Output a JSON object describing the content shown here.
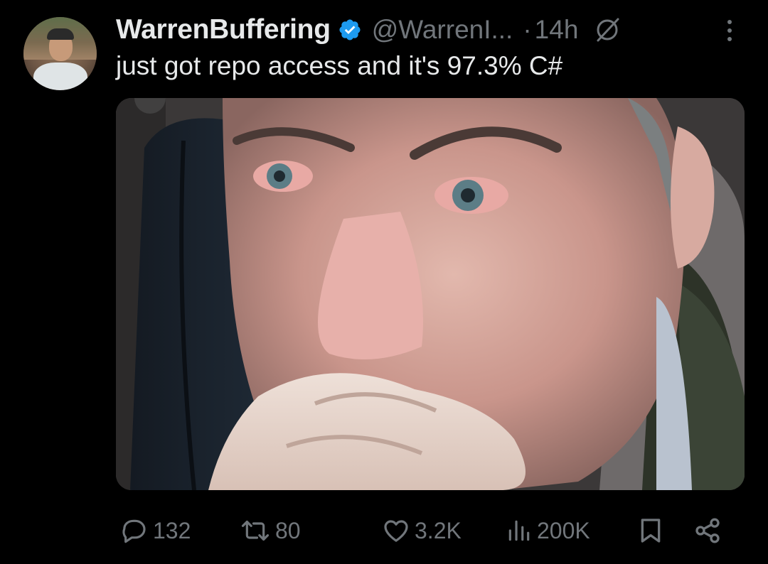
{
  "tweet": {
    "author_name": "WarrenBuffering",
    "handle": "@WarrenI...",
    "time": "14h",
    "text": "just got repo access and it's 97.3% C#",
    "verified_icon": "verified-badge-icon",
    "grok_icon": "grok-icon",
    "more_icon": "more-vertical-icon"
  },
  "actions": {
    "reply_count": "132",
    "retweet_count": "80",
    "like_count": "3.2K",
    "views_count": "200K"
  },
  "colors": {
    "background": "#000000",
    "text": "#e7e9ea",
    "muted": "#71767b",
    "verified": "#1d9bf0"
  }
}
